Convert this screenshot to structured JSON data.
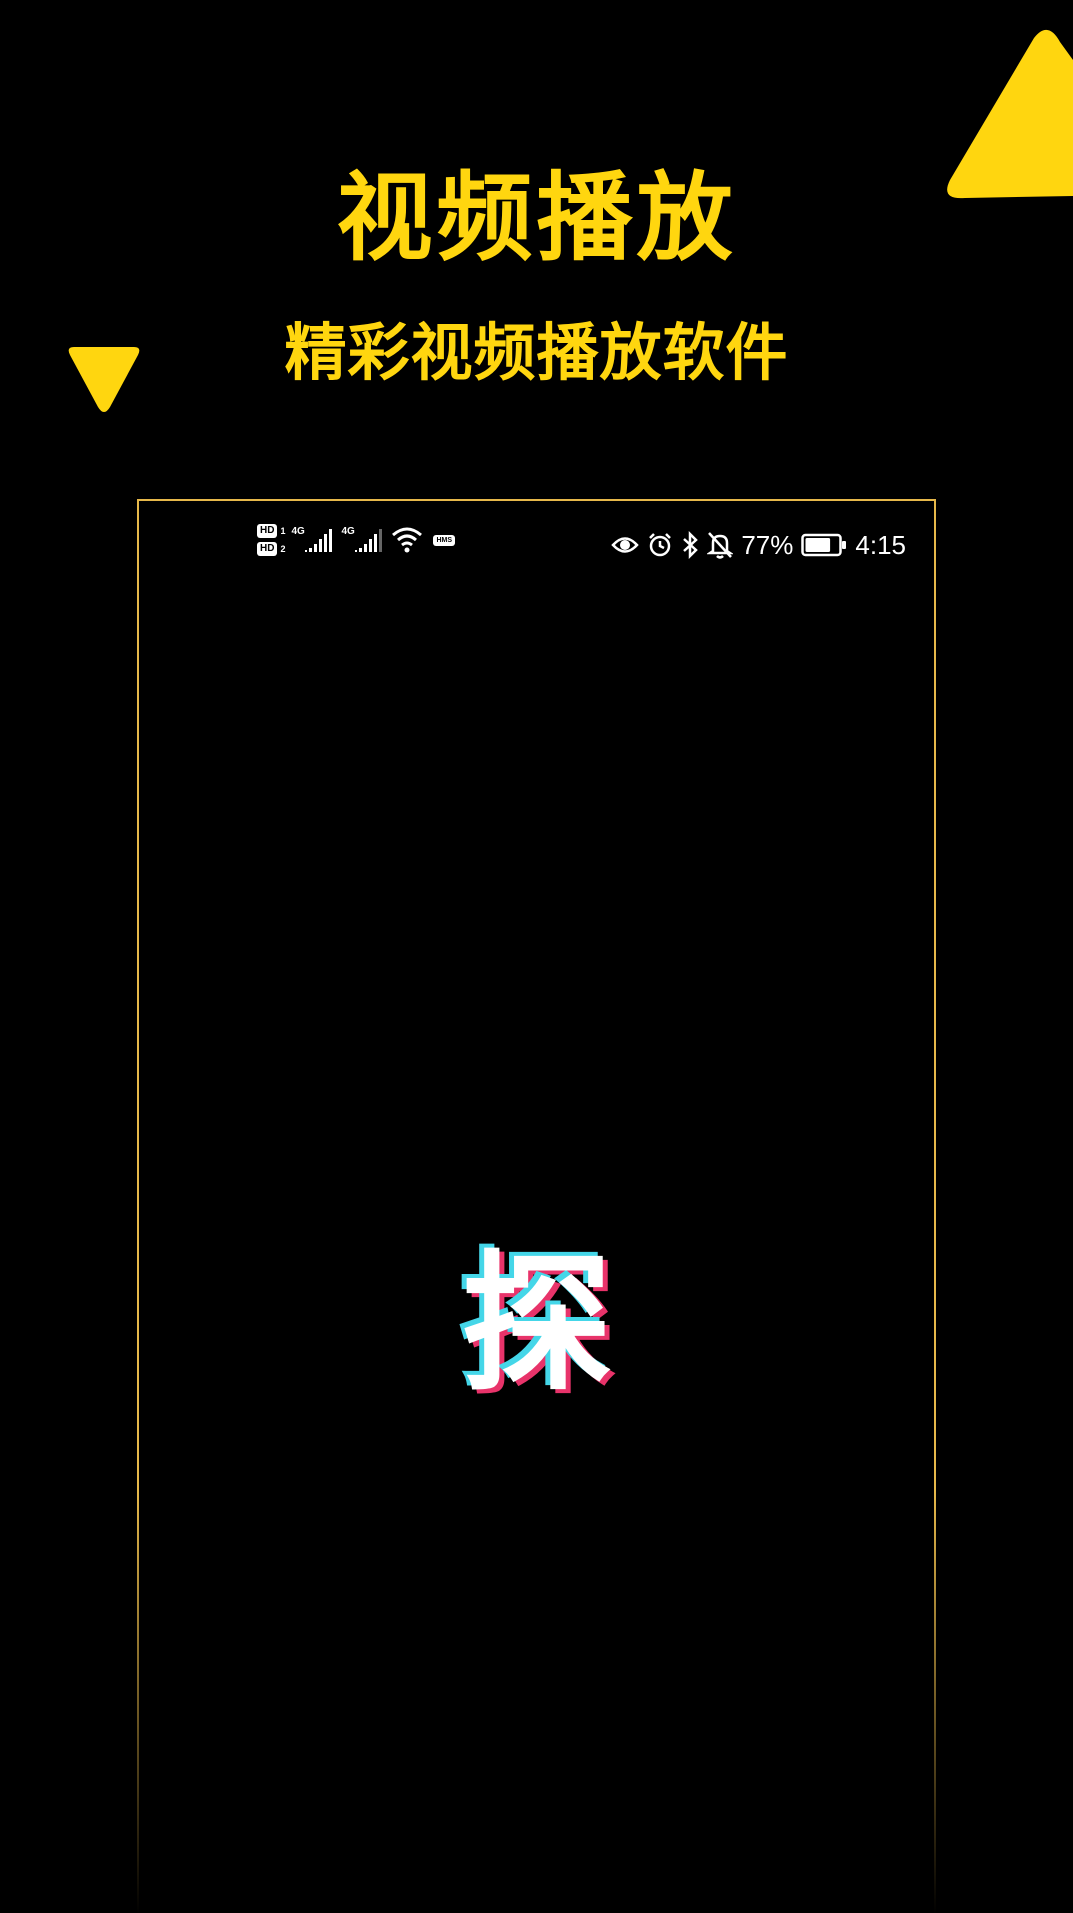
{
  "promo": {
    "title": "视频播放",
    "subtitle": "精彩视频播放软件",
    "accent_color": "#FFD60F"
  },
  "statusbar": {
    "sim1": {
      "badge": "HD",
      "slot": "1"
    },
    "sim2": {
      "badge": "HD",
      "slot": "2"
    },
    "network1": "4G",
    "network2": "4G",
    "hms_badge": "HMS",
    "icons": [
      "eye-icon",
      "alarm-icon",
      "bluetooth-icon",
      "bell-off-icon"
    ],
    "battery_percent": "77%",
    "battery_level": 0.77,
    "time": "4:15"
  },
  "splash": {
    "logo_text": "探",
    "logo_colors": {
      "fill": "#FFFFFF",
      "cyan": "#44D6E8",
      "pink": "#E8336A"
    }
  }
}
